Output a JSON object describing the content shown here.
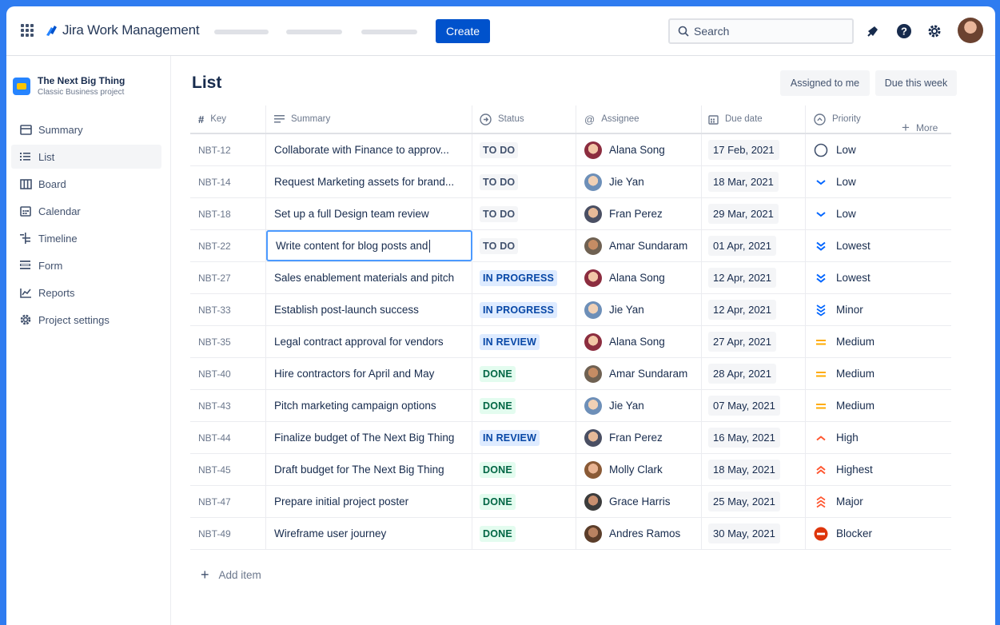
{
  "topnav": {
    "app_name": "Jira Work Management",
    "create_label": "Create",
    "search_placeholder": "Search"
  },
  "sidebar": {
    "project_name": "The Next Big Thing",
    "project_type": "Classic Business project",
    "items": [
      {
        "label": "Summary",
        "icon": "summary-icon"
      },
      {
        "label": "List",
        "icon": "list-icon",
        "active": true
      },
      {
        "label": "Board",
        "icon": "board-icon"
      },
      {
        "label": "Calendar",
        "icon": "calendar-icon"
      },
      {
        "label": "Timeline",
        "icon": "timeline-icon"
      },
      {
        "label": "Form",
        "icon": "form-icon"
      },
      {
        "label": "Reports",
        "icon": "reports-icon"
      },
      {
        "label": "Project settings",
        "icon": "gear-icon"
      }
    ]
  },
  "main": {
    "title": "List",
    "filters": [
      "Assigned to me",
      "Due this week"
    ],
    "columns": {
      "key": "Key",
      "summary": "Summary",
      "status": "Status",
      "assignee": "Assignee",
      "due": "Due date",
      "priority": "Priority",
      "more": "More"
    },
    "rows": [
      {
        "key": "NBT-12",
        "summary": "Collaborate with Finance to approv...",
        "status": "TO DO",
        "assignee": "Alana Song",
        "due": "17 Feb, 2021",
        "priority": "Low"
      },
      {
        "key": "NBT-14",
        "summary": "Request Marketing assets for brand...",
        "status": "TO DO",
        "assignee": "Jie Yan",
        "due": "18 Mar, 2021",
        "priority": "Low"
      },
      {
        "key": "NBT-18",
        "summary": "Set up a full Design team review",
        "status": "TO DO",
        "assignee": "Fran Perez",
        "due": "29 Mar, 2021",
        "priority": "Low"
      },
      {
        "key": "NBT-22",
        "summary": "Write content for blog posts and",
        "status": "TO DO",
        "assignee": "Amar Sundaram",
        "due": "01 Apr, 2021",
        "priority": "Lowest"
      },
      {
        "key": "NBT-27",
        "summary": "Sales enablement materials and pitch",
        "status": "IN PROGRESS",
        "assignee": "Alana Song",
        "due": "12 Apr, 2021",
        "priority": "Lowest"
      },
      {
        "key": "NBT-33",
        "summary": "Establish post-launch success",
        "status": "IN PROGRESS",
        "assignee": "Jie Yan",
        "due": "12 Apr, 2021",
        "priority": "Minor"
      },
      {
        "key": "NBT-35",
        "summary": "Legal contract approval for vendors",
        "status": "IN REVIEW",
        "assignee": "Alana Song",
        "due": "27 Apr, 2021",
        "priority": "Medium"
      },
      {
        "key": "NBT-40",
        "summary": "Hire contractors for April and May",
        "status": "DONE",
        "assignee": "Amar Sundaram",
        "due": "28 Apr, 2021",
        "priority": "Medium"
      },
      {
        "key": "NBT-43",
        "summary": "Pitch marketing campaign options",
        "status": "DONE",
        "assignee": "Jie Yan",
        "due": "07 May, 2021",
        "priority": "Medium"
      },
      {
        "key": "NBT-44",
        "summary": "Finalize budget of The Next Big Thing",
        "status": "IN REVIEW",
        "assignee": "Fran Perez",
        "due": "16 May, 2021",
        "priority": "High"
      },
      {
        "key": "NBT-45",
        "summary": "Draft budget for The Next Big Thing",
        "status": "DONE",
        "assignee": "Molly Clark",
        "due": "18 May, 2021",
        "priority": "Highest"
      },
      {
        "key": "NBT-47",
        "summary": "Prepare initial project poster",
        "status": "DONE",
        "assignee": "Grace Harris",
        "due": "25 May, 2021",
        "priority": "Major"
      },
      {
        "key": "NBT-49",
        "summary": "Wireframe user journey",
        "status": "DONE",
        "assignee": "Andres Ramos",
        "due": "30 May, 2021",
        "priority": "Blocker"
      }
    ],
    "add_item_label": "Add item"
  },
  "colors": {
    "brand": "#0052CC",
    "frame": "#2f7cf0",
    "todo_bg": "#F4F5F7",
    "inprogress_bg": "#DEEBFF",
    "done_bg": "#E3FCEF",
    "low": "#0065FF",
    "medium": "#FFAB00",
    "high": "#FF5630",
    "blocker": "#DE350B"
  }
}
